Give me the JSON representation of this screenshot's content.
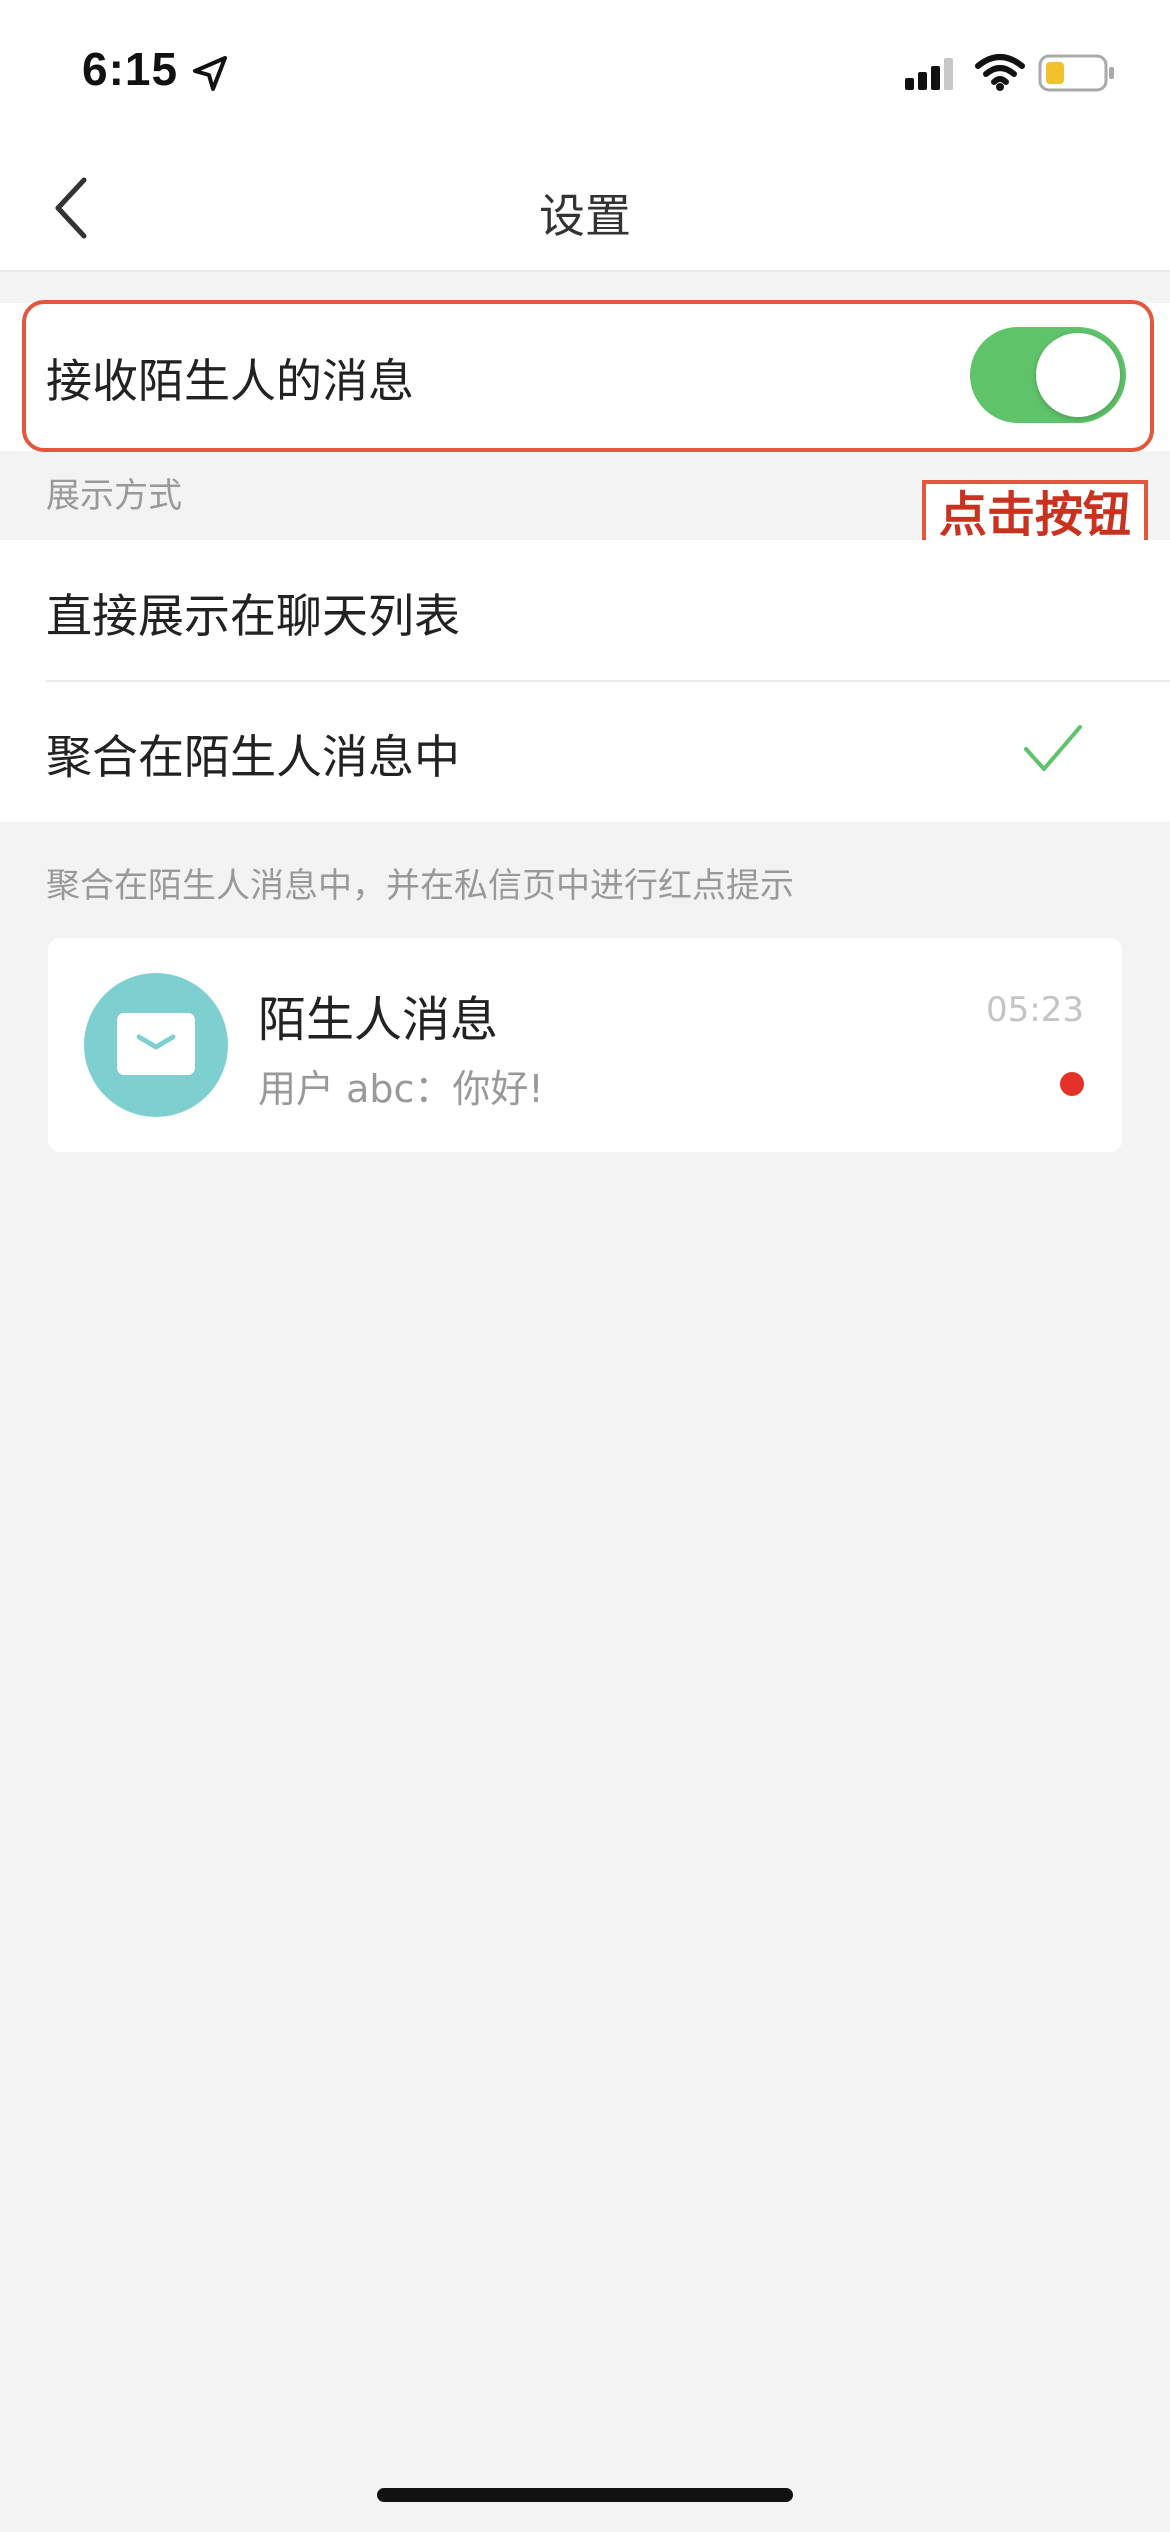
{
  "status_bar": {
    "time": "6:15",
    "icons": [
      "location-arrow-icon",
      "cellular-signal-icon",
      "wifi-icon",
      "battery-low-icon"
    ],
    "battery_color": "#f2c12e"
  },
  "nav": {
    "title": "设置",
    "back_icon": "chevron-left-icon"
  },
  "receive_strangers": {
    "label": "接收陌生人的消息",
    "enabled": true,
    "switch_color": "#5fc36a"
  },
  "annotation": {
    "tag": "点击按钮",
    "color": "#e3573c"
  },
  "display_mode": {
    "caption": "展示方式",
    "options": [
      {
        "label": "直接展示在聊天列表",
        "selected": false
      },
      {
        "label": "聚合在陌生人消息中",
        "selected": true
      }
    ],
    "check_color": "#5fc36a",
    "footnote": "聚合在陌生人消息中，并在私信页中进行红点提示"
  },
  "preview": {
    "title": "陌生人消息",
    "subtitle": "用户 abc：你好!",
    "time": "05:23",
    "avatar_color": "#7ed0d0",
    "unread_dot_color": "#e4312a",
    "icon": "envelope-icon"
  }
}
